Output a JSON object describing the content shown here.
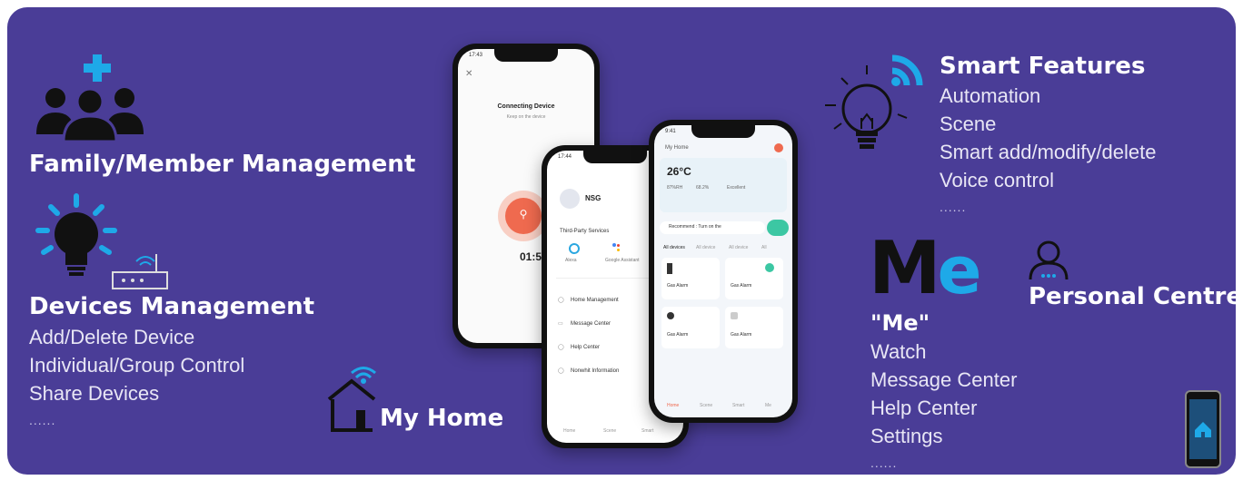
{
  "family": {
    "title": "Family/Member Management"
  },
  "devices": {
    "title": "Devices Management",
    "items": [
      "Add/Delete Device",
      "Individual/Group Control",
      "Share Devices"
    ],
    "more": "......"
  },
  "my_home": {
    "title": "My Home"
  },
  "smart": {
    "title": "Smart Features",
    "items": [
      "Automation",
      "Scene",
      "Smart add/modify/delete",
      "Voice control"
    ],
    "more": "......"
  },
  "me": {
    "logo": "Me",
    "title": "\"Me\"",
    "items": [
      "Watch",
      "Message Center",
      "Help Center",
      "Settings"
    ],
    "more": "......"
  },
  "personal": {
    "title": "Personal Centre"
  },
  "phone1": {
    "time": "17:43",
    "title": "Connecting Device",
    "subtitle": "Keep on the device",
    "timer": "01:59"
  },
  "phone2": {
    "time": "17:44",
    "name": "NSG",
    "third_party": "Third-Party Services",
    "services": [
      "Alexa",
      "Google Assistant"
    ],
    "menu": [
      "Home Management",
      "Message Center",
      "Help Center",
      "Nonwhit Information"
    ],
    "tabs": [
      "Home",
      "Scene",
      "Smart"
    ]
  },
  "phone3": {
    "time": "9:41",
    "home": "My Home",
    "temp": "26°C",
    "stats": [
      "87%RH",
      "68.2%",
      "Excellent"
    ],
    "recommend": "Recommend : Turn on the",
    "filters": [
      "All devices",
      "All device",
      "All device",
      "All"
    ],
    "devices": [
      "Gas Alarm",
      "Gas Alarm",
      "Gas Alarm",
      "Gas Alarm"
    ],
    "tabs": [
      "Home",
      "Scene",
      "Smart",
      "Me"
    ]
  },
  "colors": {
    "background": "#4a3d97",
    "accent_cyan": "#1ea9e8",
    "text": "#ffffff"
  }
}
